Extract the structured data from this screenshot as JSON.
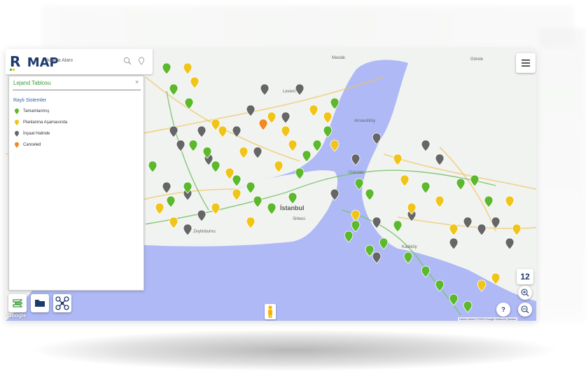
{
  "header": {
    "logo_letter": "R",
    "logo_text": "MAP",
    "search_placeholder": "Arama Alanı"
  },
  "legend": {
    "title": "Lejand Tablosu",
    "close": "×",
    "section": "Raylı Sistemler",
    "items": [
      {
        "label": "Tamamlanmış",
        "color": "#5cb82c"
      },
      {
        "label": "Planlanma Aşamasında",
        "color": "#f0c419"
      },
      {
        "label": "İnşaat Halinde",
        "color": "#666666"
      },
      {
        "label": "Canceled",
        "color": "#f08a24"
      }
    ]
  },
  "map": {
    "labels": {
      "maslak": "Maslak",
      "gorele": "Görele",
      "levent": "Levent",
      "arnavutkoy": "Arnavutköy",
      "istanbul": "İstanbul",
      "sirkeci": "Sirkeci",
      "zeytinburnu": "Zeytinburnu",
      "uskudar": "Üsküdar",
      "kadikoy": "Kadıköy",
      "google": "Google",
      "attribution": "Harita verileri ©2023 Google   Kullanım Şartları"
    },
    "zoom_level": "12",
    "help": "?",
    "colors": {
      "water": "#aeb9f5",
      "land": "#f1f3f1",
      "rail": "#7cc26a",
      "road": "#f0c35a",
      "completed": "#5cb82c",
      "planned": "#f0c419",
      "construction": "#666666",
      "canceled": "#f08a24"
    }
  },
  "toolbar": {
    "tools": [
      "layers-icon",
      "folder-icon",
      "drone-icon"
    ]
  }
}
